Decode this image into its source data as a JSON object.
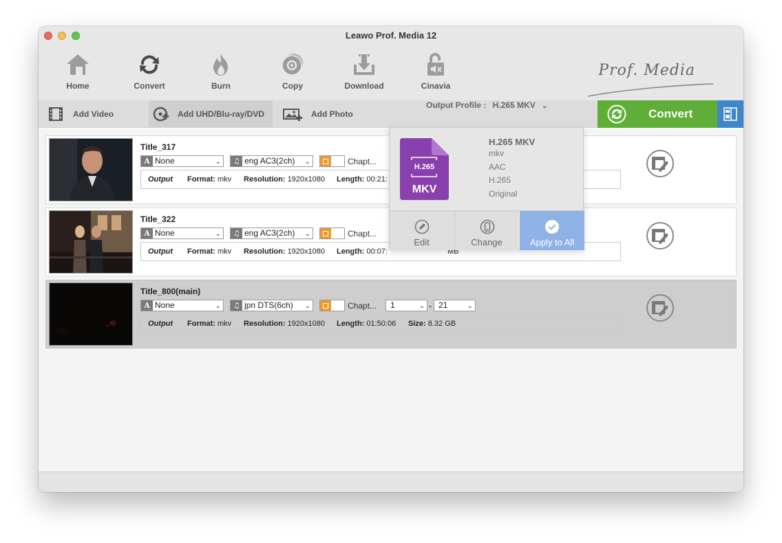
{
  "window": {
    "title": "Leawo Prof. Media 12"
  },
  "toolbar": {
    "items": [
      {
        "label": "Home",
        "icon": "home-icon"
      },
      {
        "label": "Convert",
        "icon": "convert-icon"
      },
      {
        "label": "Burn",
        "icon": "burn-icon"
      },
      {
        "label": "Copy",
        "icon": "copy-icon"
      },
      {
        "label": "Download",
        "icon": "download-icon"
      },
      {
        "label": "Cinavia",
        "icon": "cinavia-icon"
      }
    ],
    "logo_text": "Prof. Media"
  },
  "actionbar": {
    "add_video": "Add Video",
    "add_disc": "Add UHD/Blu-ray/DVD",
    "add_photo": "Add Photo",
    "output_profile_label": "Output Profile :",
    "output_profile_value": "H.265 MKV",
    "convert_label": "Convert"
  },
  "colors": {
    "convert_green": "#5fae37",
    "accent_blue": "#3d86c9",
    "subtitle_orange": "#ec9a2f",
    "mkv_purple": "#8a3fae"
  },
  "titles": [
    {
      "name": "Title_317",
      "subtitle": "None",
      "audio": "eng AC3(2ch)",
      "chapters_label": "Chapt...",
      "output_label": "Output",
      "format_label": "Format:",
      "format": "mkv",
      "resolution_label": "Resolution:",
      "resolution": "1920x1080",
      "length_label": "Length:",
      "length": "00:21:"
    },
    {
      "name": "Title_322",
      "subtitle": "None",
      "audio": "eng AC3(2ch)",
      "chapters_label": "Chapt...",
      "output_label": "Output",
      "format_label": "Format:",
      "format": "mkv",
      "resolution_label": "Resolution:",
      "resolution": "1920x1080",
      "length_label": "Length:",
      "length": "00:07:",
      "size_fragment": "MB"
    },
    {
      "name": "Title_800(main)",
      "subtitle": "None",
      "audio": "jpn DTS(6ch)",
      "chapters_label": "Chapt...",
      "chapter_from": "1",
      "chapter_sep": "-",
      "chapter_to": "21",
      "output_label": "Output",
      "format_label": "Format:",
      "format": "mkv",
      "resolution_label": "Resolution:",
      "resolution": "1920x1080",
      "length_label": "Length:",
      "length": "01:50:06",
      "size_label": "Size:",
      "size": "8.32 GB"
    }
  ],
  "profile_popup": {
    "icon_codec": "H.265",
    "icon_format": "MKV",
    "name": "H.265 MKV",
    "container": "mkv",
    "audio": "AAC",
    "video": "H.265",
    "resolution": "Original",
    "edit": "Edit",
    "change": "Change",
    "apply_all": "Apply to All"
  }
}
